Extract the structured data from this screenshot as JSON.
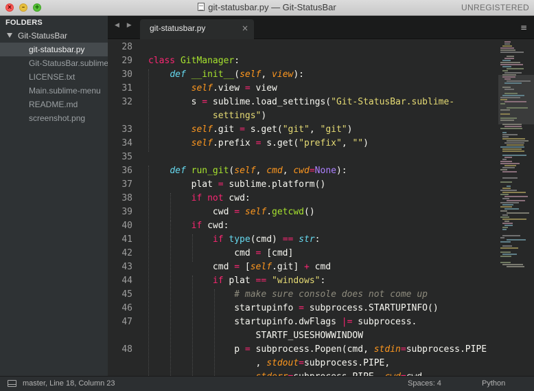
{
  "window": {
    "title": "git-statusbar.py — Git-StatusBar",
    "license_status": "UNREGISTERED"
  },
  "sidebar": {
    "header": "FOLDERS",
    "folder": "Git-StatusBar",
    "files": [
      {
        "name": "git-statusbar.py",
        "active": true
      },
      {
        "name": "Git-StatusBar.sublime-settings",
        "active": false
      },
      {
        "name": "LICENSE.txt",
        "active": false
      },
      {
        "name": "Main.sublime-menu",
        "active": false
      },
      {
        "name": "README.md",
        "active": false
      },
      {
        "name": "screenshot.png",
        "active": false
      }
    ]
  },
  "tabs": {
    "nav": "◀ ▶",
    "active_tab": "git-statusbar.py",
    "close_glyph": "×",
    "menu_glyph": "≡"
  },
  "editor": {
    "line_numbers": [
      "28",
      "29",
      "30",
      "31",
      "32",
      "",
      "33",
      "34",
      "35",
      "36",
      "37",
      "38",
      "39",
      "40",
      "41",
      "42",
      "43",
      "44",
      "45",
      "46",
      "47",
      "",
      "48",
      "",
      ""
    ],
    "code_lines": [
      [],
      [
        [
          "kw",
          "class"
        ],
        [
          "plain",
          " "
        ],
        [
          "cls",
          "GitManager"
        ],
        [
          "plain",
          ":"
        ]
      ],
      [
        [
          "plain",
          "    "
        ],
        [
          "def",
          "def"
        ],
        [
          "plain",
          " "
        ],
        [
          "fn",
          "__init__"
        ],
        [
          "plain",
          "("
        ],
        [
          "slf",
          "self"
        ],
        [
          "plain",
          ", "
        ],
        [
          "prm",
          "view"
        ],
        [
          "plain",
          "):"
        ]
      ],
      [
        [
          "plain",
          "        "
        ],
        [
          "slf",
          "self"
        ],
        [
          "plain",
          ".view "
        ],
        [
          "op",
          "="
        ],
        [
          "plain",
          " view"
        ]
      ],
      [
        [
          "plain",
          "        s "
        ],
        [
          "op",
          "="
        ],
        [
          "plain",
          " sublime.load_settings("
        ],
        [
          "str",
          "\"Git-StatusBar.sublime-"
        ]
      ],
      [
        [
          "str",
          "            settings\""
        ],
        [
          "plain",
          ")"
        ]
      ],
      [
        [
          "plain",
          "        "
        ],
        [
          "slf",
          "self"
        ],
        [
          "plain",
          ".git "
        ],
        [
          "op",
          "="
        ],
        [
          "plain",
          " s.get("
        ],
        [
          "str",
          "\"git\""
        ],
        [
          "plain",
          ", "
        ],
        [
          "str",
          "\"git\""
        ],
        [
          "plain",
          ")"
        ]
      ],
      [
        [
          "plain",
          "        "
        ],
        [
          "slf",
          "self"
        ],
        [
          "plain",
          ".prefix "
        ],
        [
          "op",
          "="
        ],
        [
          "plain",
          " s.get("
        ],
        [
          "str",
          "\"prefix\""
        ],
        [
          "plain",
          ", "
        ],
        [
          "str",
          "\"\""
        ],
        [
          "plain",
          ")"
        ]
      ],
      [],
      [
        [
          "plain",
          "    "
        ],
        [
          "def",
          "def"
        ],
        [
          "plain",
          " "
        ],
        [
          "fn",
          "run_git"
        ],
        [
          "plain",
          "("
        ],
        [
          "slf",
          "self"
        ],
        [
          "plain",
          ", "
        ],
        [
          "prm",
          "cmd"
        ],
        [
          "plain",
          ", "
        ],
        [
          "prm",
          "cwd"
        ],
        [
          "op",
          "="
        ],
        [
          "cst",
          "None"
        ],
        [
          "plain",
          "):"
        ]
      ],
      [
        [
          "plain",
          "        plat "
        ],
        [
          "op",
          "="
        ],
        [
          "plain",
          " sublime.platform()"
        ]
      ],
      [
        [
          "plain",
          "        "
        ],
        [
          "kw",
          "if"
        ],
        [
          "plain",
          " "
        ],
        [
          "kw",
          "not"
        ],
        [
          "plain",
          " cwd:"
        ]
      ],
      [
        [
          "plain",
          "            cwd "
        ],
        [
          "op",
          "="
        ],
        [
          "plain",
          " "
        ],
        [
          "slf",
          "self"
        ],
        [
          "plain",
          "."
        ],
        [
          "fn",
          "getcwd"
        ],
        [
          "plain",
          "()"
        ]
      ],
      [
        [
          "plain",
          "        "
        ],
        [
          "kw",
          "if"
        ],
        [
          "plain",
          " cwd:"
        ]
      ],
      [
        [
          "plain",
          "            "
        ],
        [
          "kw",
          "if"
        ],
        [
          "plain",
          " "
        ],
        [
          "bi",
          "type"
        ],
        [
          "plain",
          "(cmd) "
        ],
        [
          "op",
          "=="
        ],
        [
          "plain",
          " "
        ],
        [
          "bii",
          "str"
        ],
        [
          "plain",
          ":"
        ]
      ],
      [
        [
          "plain",
          "                cmd "
        ],
        [
          "op",
          "="
        ],
        [
          "plain",
          " [cmd]"
        ]
      ],
      [
        [
          "plain",
          "            cmd "
        ],
        [
          "op",
          "="
        ],
        [
          "plain",
          " ["
        ],
        [
          "slf",
          "self"
        ],
        [
          "plain",
          ".git] "
        ],
        [
          "op",
          "+"
        ],
        [
          "plain",
          " cmd"
        ]
      ],
      [
        [
          "plain",
          "            "
        ],
        [
          "kw",
          "if"
        ],
        [
          "plain",
          " plat "
        ],
        [
          "op",
          "=="
        ],
        [
          "plain",
          " "
        ],
        [
          "str",
          "\"windows\""
        ],
        [
          "plain",
          ":"
        ]
      ],
      [
        [
          "cmt",
          "                # make sure console does not come up"
        ]
      ],
      [
        [
          "plain",
          "                startupinfo "
        ],
        [
          "op",
          "="
        ],
        [
          "plain",
          " subprocess.STARTUPINFO()"
        ]
      ],
      [
        [
          "plain",
          "                startupinfo.dwFlags "
        ],
        [
          "op",
          "|="
        ],
        [
          "plain",
          " subprocess."
        ]
      ],
      [
        [
          "plain",
          "                    STARTF_USESHOWWINDOW"
        ]
      ],
      [
        [
          "plain",
          "                p "
        ],
        [
          "op",
          "="
        ],
        [
          "plain",
          " subprocess.Popen(cmd, "
        ],
        [
          "prm",
          "stdin"
        ],
        [
          "op",
          "="
        ],
        [
          "plain",
          "subprocess.PIPE"
        ]
      ],
      [
        [
          "plain",
          "                    , "
        ],
        [
          "prm",
          "stdout"
        ],
        [
          "op",
          "="
        ],
        [
          "plain",
          "subprocess.PIPE,"
        ]
      ],
      [
        [
          "plain",
          "                    "
        ],
        [
          "prm",
          "stderr"
        ],
        [
          "op",
          "="
        ],
        [
          "plain",
          "subprocess.PIPE, "
        ],
        [
          "prm",
          "cwd"
        ],
        [
          "op",
          "="
        ],
        [
          "plain",
          "cwd,"
        ]
      ]
    ]
  },
  "status_bar": {
    "position": "master, Line 18, Column 23",
    "indent": "Spaces: 4",
    "syntax": "Python"
  },
  "colors": {
    "keyword": "#f92672",
    "function": "#a6e22e",
    "string": "#e6db74",
    "parameter": "#fd971f",
    "constant": "#ae81ff",
    "builtin": "#66d9ef",
    "comment": "#8e8b7d",
    "editor_bg": "#272828",
    "sidebar_bg": "#2e3234"
  }
}
